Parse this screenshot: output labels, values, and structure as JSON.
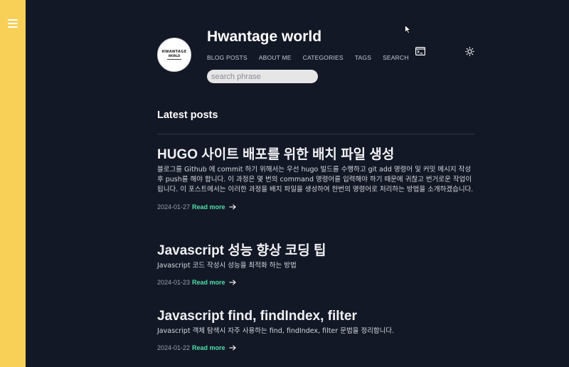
{
  "sidebar": {
    "icon": "hamburger-menu-icon",
    "color": "#f8d058"
  },
  "header": {
    "logo_line1": "HWANTAGE",
    "logo_line2": "WORLD",
    "site_title": "Hwantage world",
    "nav": [
      {
        "label": "BLOG POSTS"
      },
      {
        "label": "ABOUT ME"
      },
      {
        "label": "CATEGORIES"
      },
      {
        "label": "TAGS"
      },
      {
        "label": "SEARCH"
      }
    ],
    "search_placeholder": "search phrase",
    "icons": [
      "terminal-icon",
      "sun-icon"
    ]
  },
  "main": {
    "section_title": "Latest posts",
    "posts": [
      {
        "title": "HUGO 사이트 배포를 위한 배치 파일 생성",
        "summary": "블로그를 Github 에 commit 하기 위해서는 우선 hugo 빌드를 수행하고 git add 명령어 및 커밋 메시지 작성 후 push를 해야 합니다. 이 과정은 몇 번의 command 명령어를 입력해야 하기 때문에 귀찮고 번거로운 작업이 됩니다. 이 포스트에서는 이러한 과정을 배치 파일을 생성하여 한번의 명령어로 처리하는 방법을 소개하겠습니다.",
        "date": "2024-01-27",
        "read_more": "Read more"
      },
      {
        "title": "Javascript 성능 향상 코딩 팁",
        "summary": "Javascript 코드 작성시 성능을 최적화 하는 방법",
        "date": "2024-01-23",
        "read_more": "Read more"
      },
      {
        "title": "Javascript find, findIndex, filter",
        "summary": "Javascript 객체 탐색시 자주 사용하는 find, findIndex, filter 문법을 정리합니다.",
        "date": "2024-01-22",
        "read_more": "Read more"
      }
    ]
  },
  "colors": {
    "background": "#131826",
    "accent": "#4fe0a8",
    "sidebar": "#f8d058"
  }
}
